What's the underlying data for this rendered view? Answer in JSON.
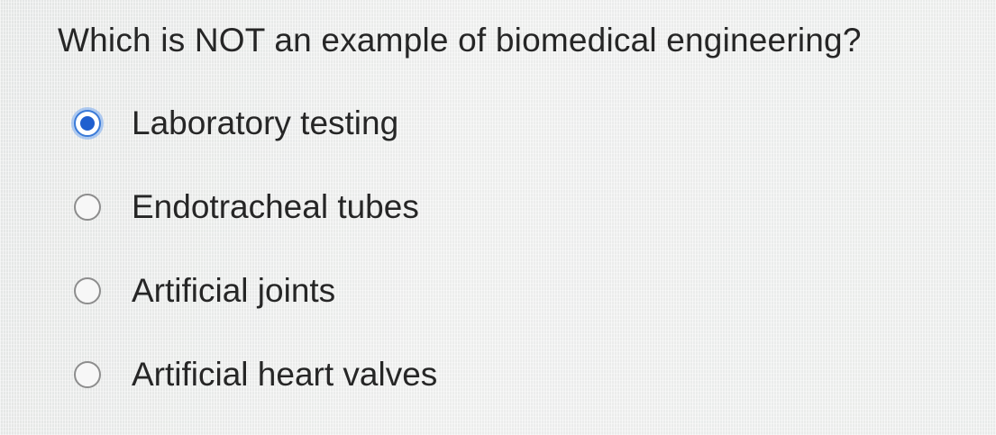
{
  "question": {
    "text": "Which is NOT an example of biomedical engineering?"
  },
  "options": [
    {
      "label": "Laboratory testing",
      "selected": true
    },
    {
      "label": "Endotracheal tubes",
      "selected": false
    },
    {
      "label": "Artificial joints",
      "selected": false
    },
    {
      "label": "Artificial heart valves",
      "selected": false
    }
  ],
  "colors": {
    "accent": "#1f5fcf",
    "text": "#262626",
    "background": "#e8eae9"
  }
}
